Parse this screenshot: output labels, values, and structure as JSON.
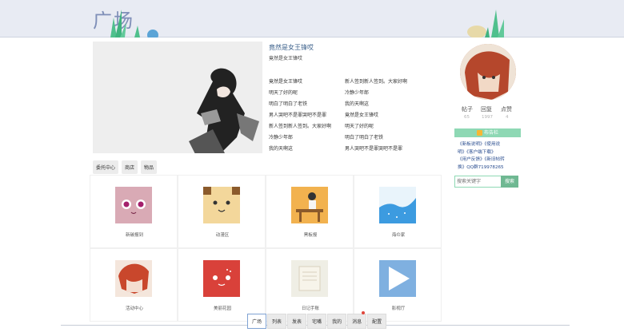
{
  "header": {
    "title": "广场"
  },
  "featured": {
    "title": "竟然是女王锋哎",
    "subtitle": "竟然是女王锋哎"
  },
  "news": {
    "left": [
      "竟然是女王锋哎",
      "明天了好的呢",
      "明白了明白了老铁",
      "男人哭吧不是罪哭吧不是罪",
      "新人签到新人签到。大家好啊",
      "冷静少年郎",
      "我的天啊这"
    ],
    "right": [
      "新人签到新人签到。大家好啊",
      "冷静少年郎",
      "我的天啊这",
      "竟然是女王锋哎",
      "明天了好的呢",
      "明白了明白了老铁",
      "男人哭吧不是罪哭吧不是罪"
    ]
  },
  "tabs": [
    "委托中心",
    "商店",
    "物品"
  ],
  "grid": [
    {
      "label": "新碳报到"
    },
    {
      "label": "动漫区"
    },
    {
      "label": "黑板报"
    },
    {
      "label": "海の家"
    },
    {
      "label": "活动中心"
    },
    {
      "label": "美丽花园"
    },
    {
      "label": "日记手账"
    },
    {
      "label": "影视厅"
    }
  ],
  "profile": {
    "stats": [
      {
        "label": "帖子",
        "value": "65"
      },
      {
        "label": "回复",
        "value": "1997"
      },
      {
        "label": "点赞",
        "value": "4"
      }
    ]
  },
  "board": {
    "header": "布告栏",
    "lines": [
      "《新板说明》《使用说",
      "明》《客户端下载》",
      "《用户反馈》《新旧帖转",
      "换》QQ群719978265"
    ]
  },
  "search": {
    "placeholder": "搜索关键字",
    "button": "搜索"
  },
  "bottom_nav": [
    "广场",
    "列表",
    "发表",
    "宅嘴",
    "我的",
    "消息",
    "配置"
  ],
  "colors": {
    "accent_green": "#8ed8b4",
    "header_bg": "#e8ebf3",
    "link": "#2a4d8f"
  }
}
